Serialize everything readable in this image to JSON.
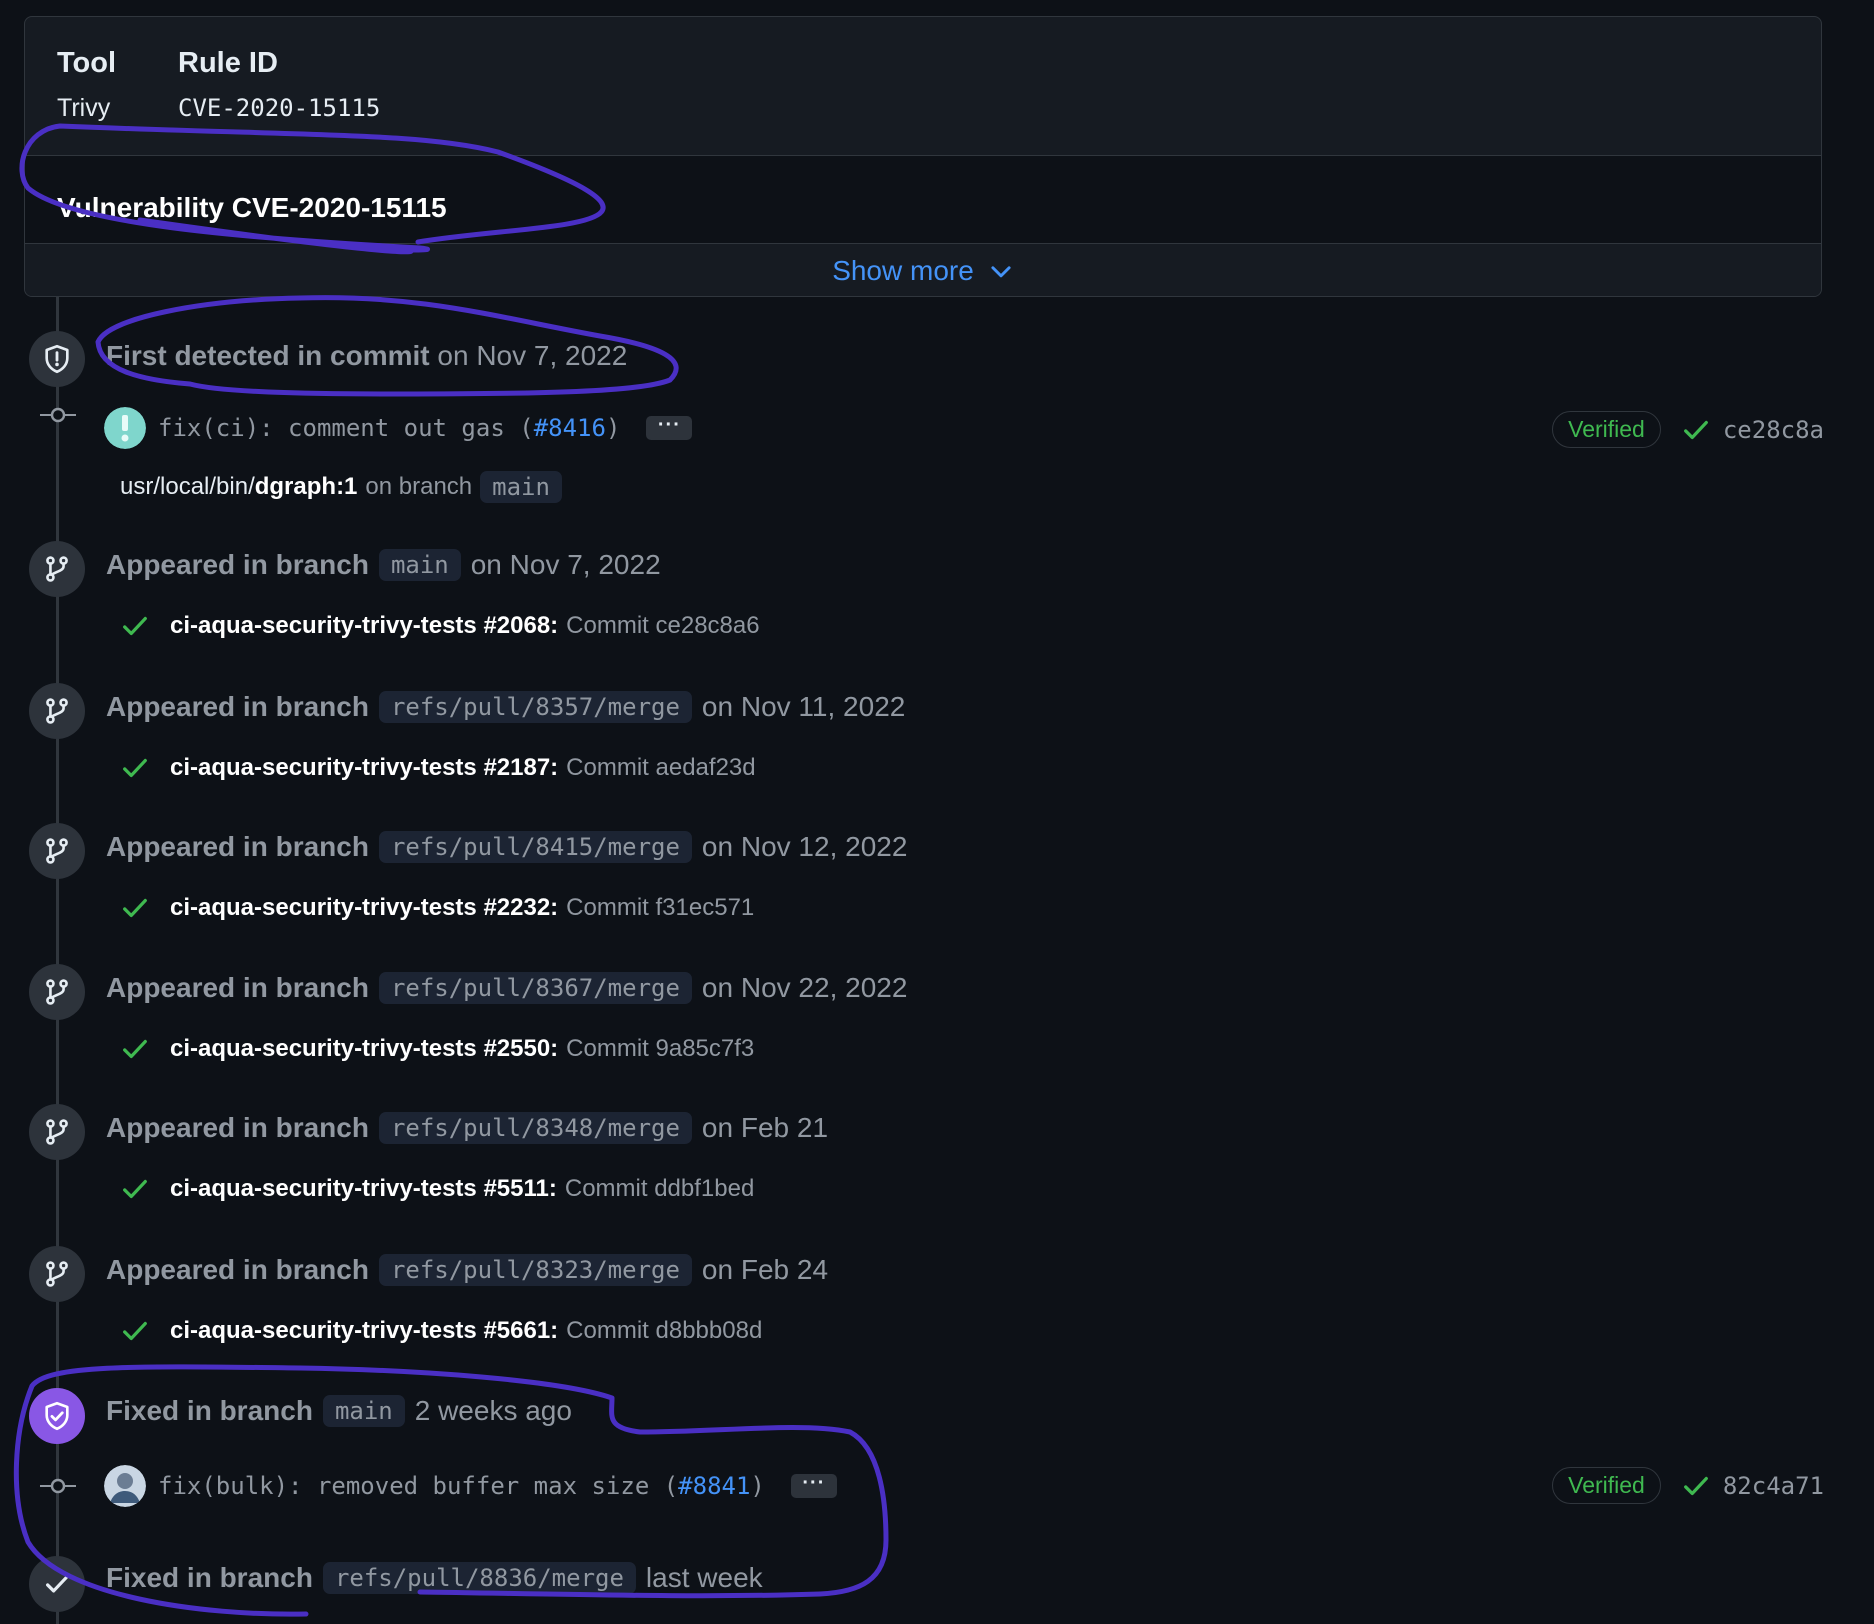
{
  "panel": {
    "tool_label": "Tool",
    "tool_value": "Trivy",
    "rule_label": "Rule ID",
    "rule_value": "CVE-2020-15115",
    "vuln_title": "Vulnerability CVE-2020-15115",
    "show_more": "Show more"
  },
  "first_detected": {
    "title_bold": "First detected in commit",
    "title_rest": "on Nov 7, 2022",
    "commit": {
      "message_prefix": "fix(ci): comment out gas (",
      "pr": "#8416",
      "message_suffix": ")",
      "ellipsis": "···",
      "verified": "Verified",
      "sha": "ce28c8a"
    },
    "location": {
      "prefix": "usr/local/bin/",
      "file": "dgraph:1",
      "on_branch": "on branch",
      "branch": "main"
    }
  },
  "events": [
    {
      "lead": "Appeared in branch",
      "branch": "main",
      "date": "on Nov 7, 2022",
      "run": "ci-aqua-security-trivy-tests #2068:",
      "commit": "Commit ce28c8a6"
    },
    {
      "lead": "Appeared in branch",
      "branch": "refs/pull/8357/merge",
      "date": "on Nov 11, 2022",
      "run": "ci-aqua-security-trivy-tests #2187:",
      "commit": "Commit aedaf23d"
    },
    {
      "lead": "Appeared in branch",
      "branch": "refs/pull/8415/merge",
      "date": "on Nov 12, 2022",
      "run": "ci-aqua-security-trivy-tests #2232:",
      "commit": "Commit f31ec571"
    },
    {
      "lead": "Appeared in branch",
      "branch": "refs/pull/8367/merge",
      "date": "on Nov 22, 2022",
      "run": "ci-aqua-security-trivy-tests #2550:",
      "commit": "Commit 9a85c7f3"
    },
    {
      "lead": "Appeared in branch",
      "branch": "refs/pull/8348/merge",
      "date": "on Feb 21",
      "run": "ci-aqua-security-trivy-tests #5511:",
      "commit": "Commit ddbf1bed"
    },
    {
      "lead": "Appeared in branch",
      "branch": "refs/pull/8323/merge",
      "date": "on Feb 24",
      "run": "ci-aqua-security-trivy-tests #5661:",
      "commit": "Commit d8bbb08d"
    }
  ],
  "fixed_main": {
    "lead": "Fixed in branch",
    "branch": "main",
    "date": "2 weeks ago",
    "commit": {
      "message_prefix": "fix(bulk): removed buffer max size (",
      "pr": "#8841",
      "message_suffix": ")",
      "ellipsis": "···",
      "verified": "Verified",
      "sha": "82c4a71"
    }
  },
  "fixed_pr": {
    "lead": "Fixed in branch",
    "branch": "refs/pull/8836/merge",
    "date": "last week"
  },
  "colors": {
    "background": "#0d1117",
    "link": "#4493f8",
    "success": "#3fb950",
    "fixed_badge": "#8957e5",
    "annotation": "#4a2fc4"
  }
}
